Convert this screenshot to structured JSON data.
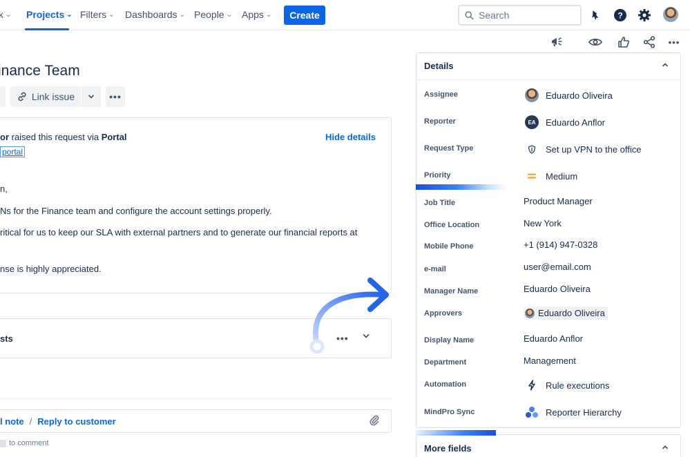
{
  "topnav": {
    "items": [
      {
        "label": "k",
        "chevron": true
      },
      {
        "label": "Projects",
        "chevron": true,
        "active": true
      },
      {
        "label": "Filters",
        "chevron": true
      },
      {
        "label": "Dashboards",
        "chevron": true
      },
      {
        "label": "People",
        "chevron": true
      },
      {
        "label": "Apps",
        "chevron": true
      }
    ],
    "create_label": "Create",
    "search_placeholder": "Search",
    "icons": [
      "notifications-icon",
      "help-icon",
      "settings-icon",
      "user-avatar"
    ]
  },
  "issue": {
    "title": "inance Team",
    "toolbar": {
      "link_issue_label": "Link issue"
    }
  },
  "request": {
    "raised_prefix": "or",
    "raised_middle": " raised this request via ",
    "raised_channel": "Portal",
    "portal_link": "portal",
    "hide_details": "Hide details",
    "body_lines": [
      "n,",
      "Ns for the Finance team and configure the account settings properly.",
      "ritical for us to keep our SLA with external partners and to generate our financial reports at",
      "nse is highly appreciated."
    ]
  },
  "approvals": {
    "label": "sts"
  },
  "comment": {
    "add_note": "l note",
    "separator": "/",
    "reply": "Reply to customer",
    "pro_tip": "to comment"
  },
  "details": {
    "title": "Details",
    "fields": [
      {
        "label": "Assignee",
        "value": "Eduardo Oliveira",
        "icon": "avatar-photo"
      },
      {
        "label": "Reporter",
        "value": "Eduardo Anflor",
        "icon": "avatar-initials",
        "initials": "EA"
      },
      {
        "label": "Request Type",
        "value": "Set up VPN to the office",
        "icon": "shield-icon"
      },
      {
        "label": "Priority",
        "value": "Medium",
        "icon": "priority-medium-icon"
      },
      {
        "label": "Job Title",
        "value": "Product Manager"
      },
      {
        "label": "Office Location",
        "value": "New York"
      },
      {
        "label": "Mobile Phone",
        "value": "+1 (914) 947-0328"
      },
      {
        "label": "e-mail",
        "value": "user@email.com"
      },
      {
        "label": "Manager Name",
        "value": "Eduardo Oliveira"
      },
      {
        "label": "Approvers",
        "value": "Eduardo Oliveira",
        "icon": "avatar-small"
      },
      {
        "label": "Display Name",
        "value": "Eduardo Anflor"
      },
      {
        "label": "Department",
        "value": "Management"
      },
      {
        "label": "Automation",
        "value": "Rule executions",
        "icon": "lightning-icon"
      },
      {
        "label": "MindPro Sync",
        "value": "Reporter Hierarchy",
        "icon": "hierarchy-icon"
      }
    ]
  },
  "more_fields": {
    "title": "More fields"
  },
  "colors": {
    "accent": "#0c66e4",
    "text": "#172b4d",
    "priority": "#f5a623"
  }
}
